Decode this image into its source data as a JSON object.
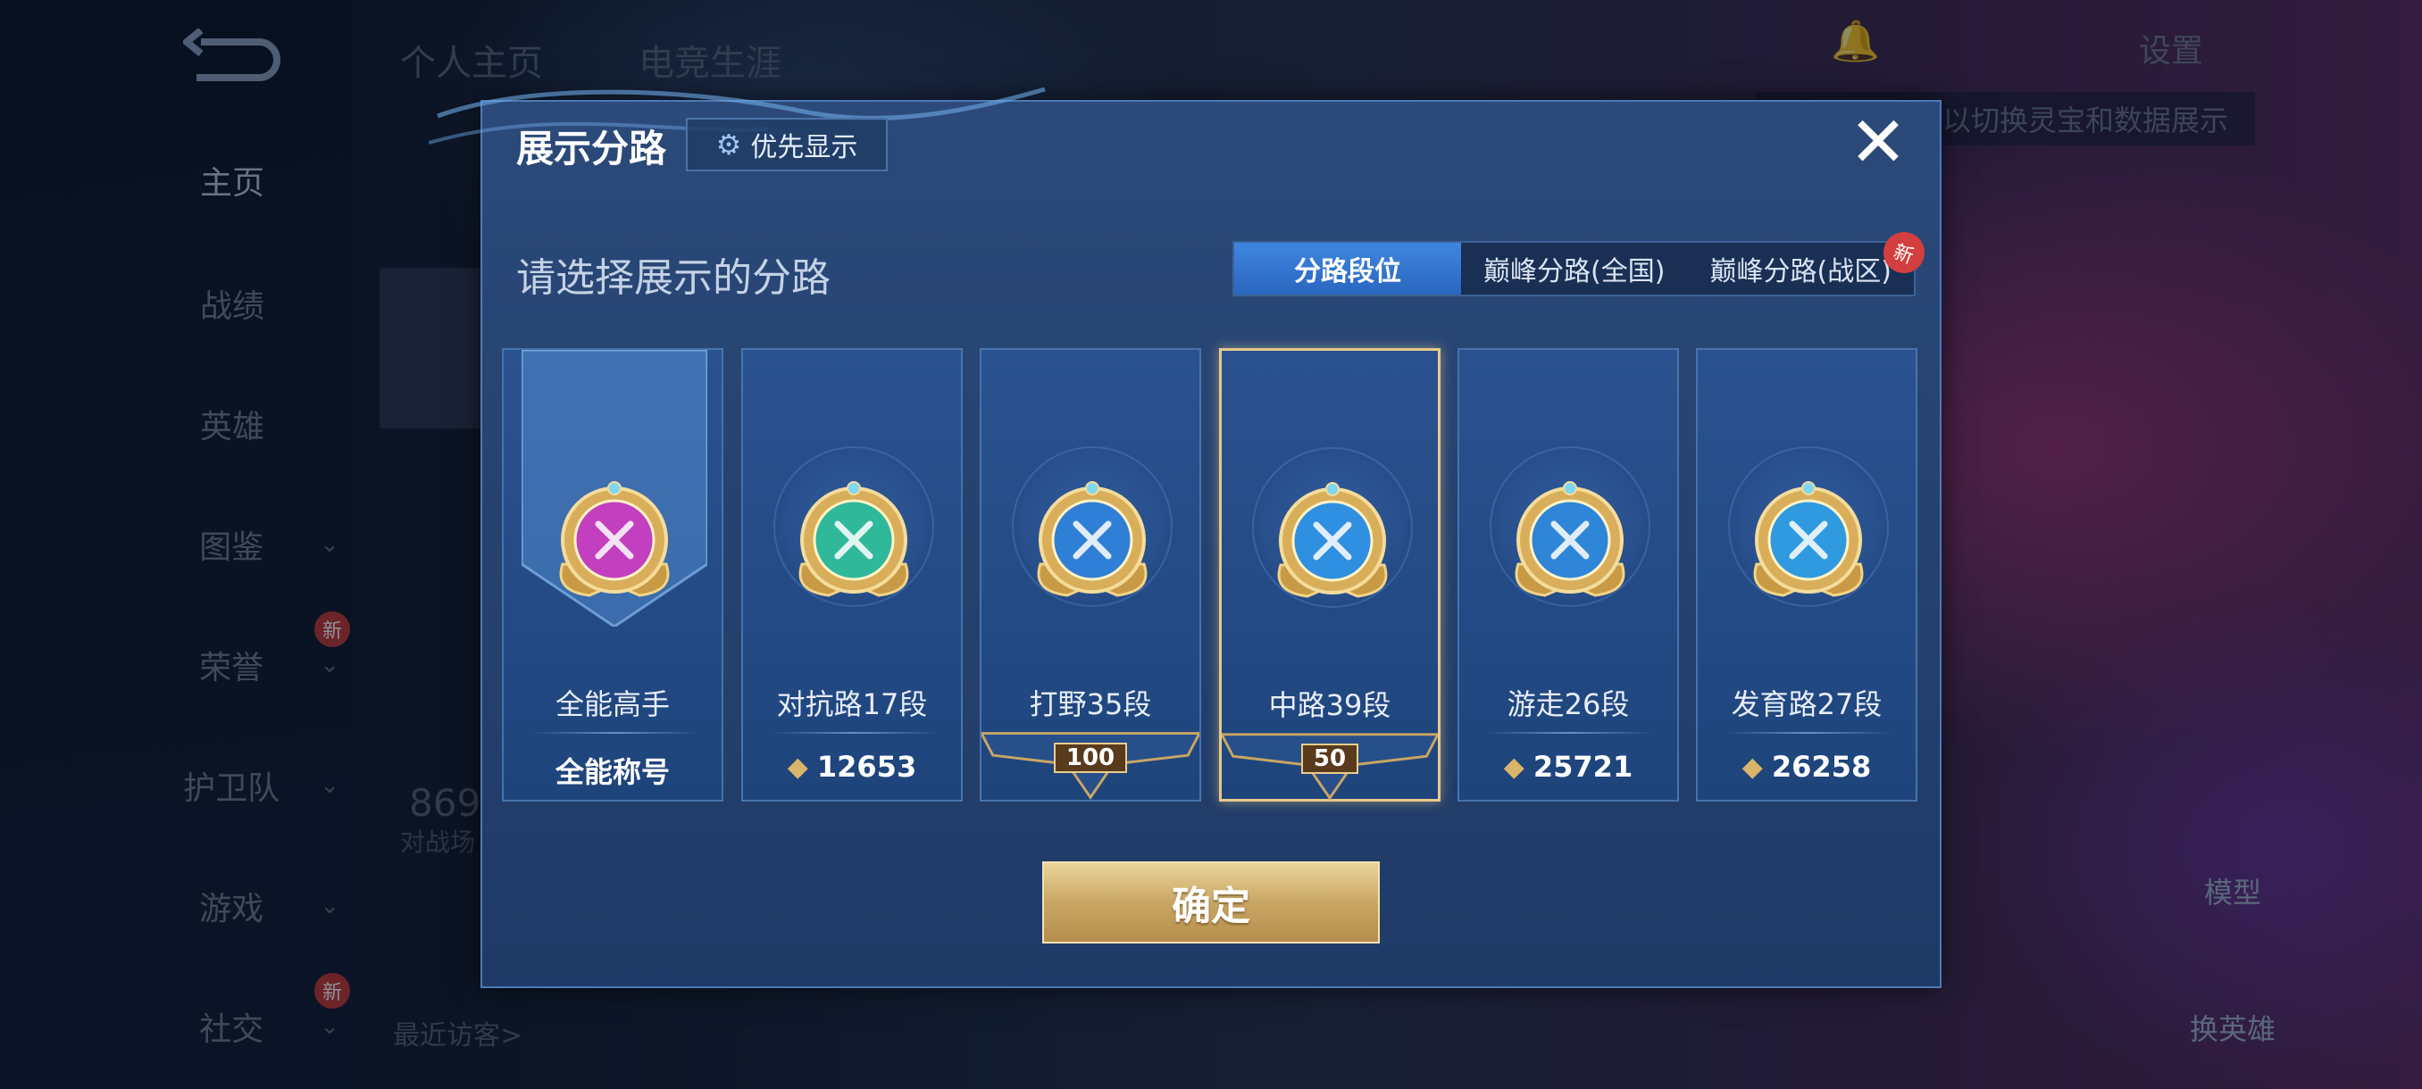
{
  "background": {
    "tabs": [
      "个人主页",
      "电竞生涯"
    ],
    "nav": [
      {
        "label": "主页",
        "active": true,
        "chevron": false,
        "badge": ""
      },
      {
        "label": "战绩",
        "active": false,
        "chevron": false,
        "badge": ""
      },
      {
        "label": "英雄",
        "active": false,
        "chevron": false,
        "badge": ""
      },
      {
        "label": "图鉴",
        "active": false,
        "chevron": true,
        "badge": ""
      },
      {
        "label": "荣誉",
        "active": false,
        "chevron": true,
        "badge": "新"
      },
      {
        "label": "护卫队",
        "active": false,
        "chevron": true,
        "badge": ""
      },
      {
        "label": "游戏",
        "active": false,
        "chevron": true,
        "badge": ""
      },
      {
        "label": "社交",
        "active": false,
        "chevron": true,
        "badge": "新"
      }
    ],
    "settings_label": "设置",
    "hint_text": "以切换灵宝和数据展示",
    "stat_value": "869",
    "stat_label": "对战场",
    "visitors_label": "最近访客>",
    "side_buttons": {
      "model": "模型",
      "change_hero": "换英雄"
    }
  },
  "dialog": {
    "title": "展示分路",
    "priority_label": "优先显示",
    "subtitle": "请选择展示的分路",
    "close_icon": "close-icon",
    "tabs": [
      {
        "label": "分路段位",
        "active": true,
        "badge": ""
      },
      {
        "label": "巅峰分路(全国)",
        "active": false,
        "badge": ""
      },
      {
        "label": "巅峰分路(战区)",
        "active": false,
        "badge": "新"
      }
    ],
    "cards": [
      {
        "lane": "全能高手",
        "score": "全能称号",
        "kind": "title",
        "emblem_color": "#c23fbf",
        "selected": false
      },
      {
        "lane": "对抗路17段",
        "score": "12653",
        "kind": "points",
        "emblem_color": "#2fb89a",
        "selected": false
      },
      {
        "lane": "打野35段",
        "score": "100",
        "kind": "rank",
        "emblem_color": "#2f7fd6",
        "selected": false
      },
      {
        "lane": "中路39段",
        "score": "50",
        "kind": "rank",
        "emblem_color": "#2f8fe0",
        "selected": true
      },
      {
        "lane": "游走26段",
        "score": "25721",
        "kind": "points",
        "emblem_color": "#2f86d8",
        "selected": false
      },
      {
        "lane": "发育路27段",
        "score": "26258",
        "kind": "points",
        "emblem_color": "#2f9ae0",
        "selected": false
      }
    ],
    "confirm_label": "确定"
  },
  "colors": {
    "dialog_bg": "#25416e",
    "accent_blue": "#3f86e0",
    "gold": "#c9a664",
    "selected_border": "#e6c98a"
  }
}
